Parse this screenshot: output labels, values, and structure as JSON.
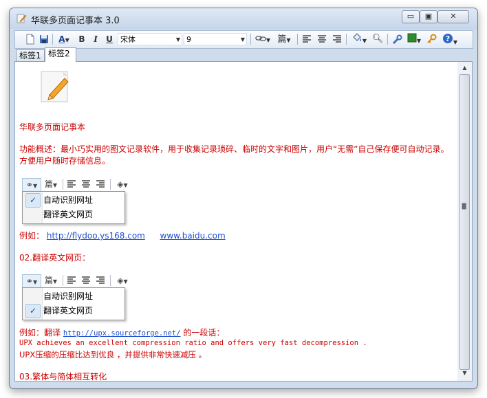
{
  "app": {
    "title": "华联多页面记事本 3.0"
  },
  "window_buttons": {
    "minimize": "▭",
    "maximize": "▣",
    "close": "✕"
  },
  "toolbar": {
    "font_name": "宋体",
    "font_size": "9",
    "buttons": {
      "bold": "B",
      "italic": "I",
      "underline": "U",
      "font_color": "A"
    }
  },
  "tabs": [
    {
      "label": "标签1",
      "active": false
    },
    {
      "label": "标签2",
      "active": true
    }
  ],
  "document": {
    "heading": "华联多页面记事本",
    "desc_line1": "功能概述：最小巧实用的图文记录软件，用于收集记录琐碎、临时的文字和图片，用户“无需”自己保存便可自动记录。",
    "desc_line2": "方便用户随时存储信息。",
    "example1": {
      "prefix": "例如：",
      "link1": "http://flydoo.ys168.com",
      "link2": "www.baidu.com"
    },
    "section2_title": "02.翻译英文网页：",
    "example2": {
      "prefix": "例如：翻译",
      "link": "http://upx.sourceforge.net/",
      "suffix": "的一段话："
    },
    "upx_en": "UPX achieves an excellent compression ratio and offers very fast decompression .",
    "upx_cn": "UPX压缩的压缩比达到优良 ，并提供非常快速减压 。",
    "section3_title": "03.繁体与简体相互转化",
    "menu1": {
      "items": [
        {
          "label": "自动识别网址",
          "checked": true
        },
        {
          "label": "翻译英文网页",
          "checked": false
        }
      ]
    },
    "menu2": {
      "items": [
        {
          "label": "自动识别网址",
          "checked": false
        },
        {
          "label": "翻译英文网页",
          "checked": true
        }
      ]
    }
  },
  "icons": [
    "notepad-icon",
    "new-doc-icon",
    "save-icon",
    "font-color-icon",
    "link-icon",
    "translate-icon",
    "align-left-icon",
    "align-center-icon",
    "align-right-icon",
    "fill-color-icon",
    "find-icon",
    "tools-icon",
    "color-box-icon",
    "key-icon",
    "help-icon"
  ],
  "colors": {
    "accent_text": "#cc0000",
    "link": "#1f4fd0",
    "frame": "#cfdcec"
  }
}
